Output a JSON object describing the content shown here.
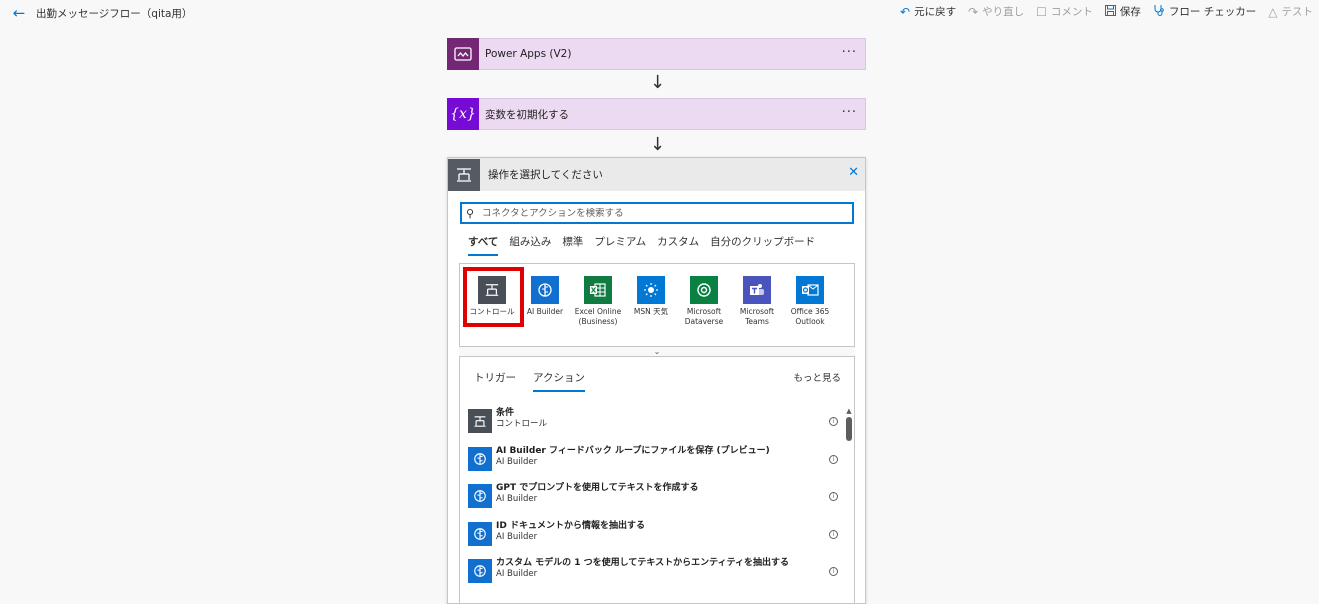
{
  "header": {
    "back_icon": "back-arrow-icon",
    "title": "出勤メッセージフロー（qita用）"
  },
  "toolbar": {
    "undo": "元に戻す",
    "redo": "やり直し",
    "comment": "コメント",
    "save": "保存",
    "checker": "フロー チェッカー",
    "test": "テスト"
  },
  "steps": [
    {
      "name": "Power Apps (V2)",
      "icon": "power-apps-icon",
      "color": "#742774"
    },
    {
      "name": "変数を初期化する",
      "icon": "variable-icon",
      "color": "#770bd6"
    }
  ],
  "chooser": {
    "title": "操作を選択してください",
    "search_placeholder": "コネクタとアクションを検索する",
    "tabs": [
      "すべて",
      "組み込み",
      "標準",
      "プレミアム",
      "カスタム",
      "自分のクリップボード"
    ],
    "active_tab": "すべて",
    "connectors": [
      {
        "label": "コントロール",
        "color": "#484f57",
        "icon": "control-icon"
      },
      {
        "label": "AI Builder",
        "color": "#1170cf",
        "icon": "ai-builder-icon"
      },
      {
        "label": "Excel Online (Business)",
        "color": "#107c41",
        "icon": "excel-icon"
      },
      {
        "label": "MSN 天気",
        "color": "#0078d4",
        "icon": "weather-icon"
      },
      {
        "label": "Microsoft Dataverse",
        "color": "#088142",
        "icon": "dataverse-icon"
      },
      {
        "label": "Microsoft Teams",
        "color": "#4b53bc",
        "icon": "teams-icon"
      },
      {
        "label": "Office 365 Outlook",
        "color": "#0078d4",
        "icon": "outlook-icon"
      }
    ],
    "subtabs": [
      "トリガー",
      "アクション"
    ],
    "active_subtab": "アクション",
    "see_more": "もっと見る",
    "actions": [
      {
        "name": "条件",
        "connector": "コントロール",
        "kind": "control"
      },
      {
        "name": "AI Builder フィードバック ループにファイルを保存 (プレビュー)",
        "connector": "AI Builder",
        "kind": "ai"
      },
      {
        "name": "GPT でプロンプトを使用してテキストを作成する",
        "connector": "AI Builder",
        "kind": "ai"
      },
      {
        "name": "ID ドキュメントから情報を抽出する",
        "connector": "AI Builder",
        "kind": "ai"
      },
      {
        "name": "カスタム モデルの 1 つを使用してテキストからエンティティを抽出する",
        "connector": "AI Builder",
        "kind": "ai"
      }
    ]
  }
}
